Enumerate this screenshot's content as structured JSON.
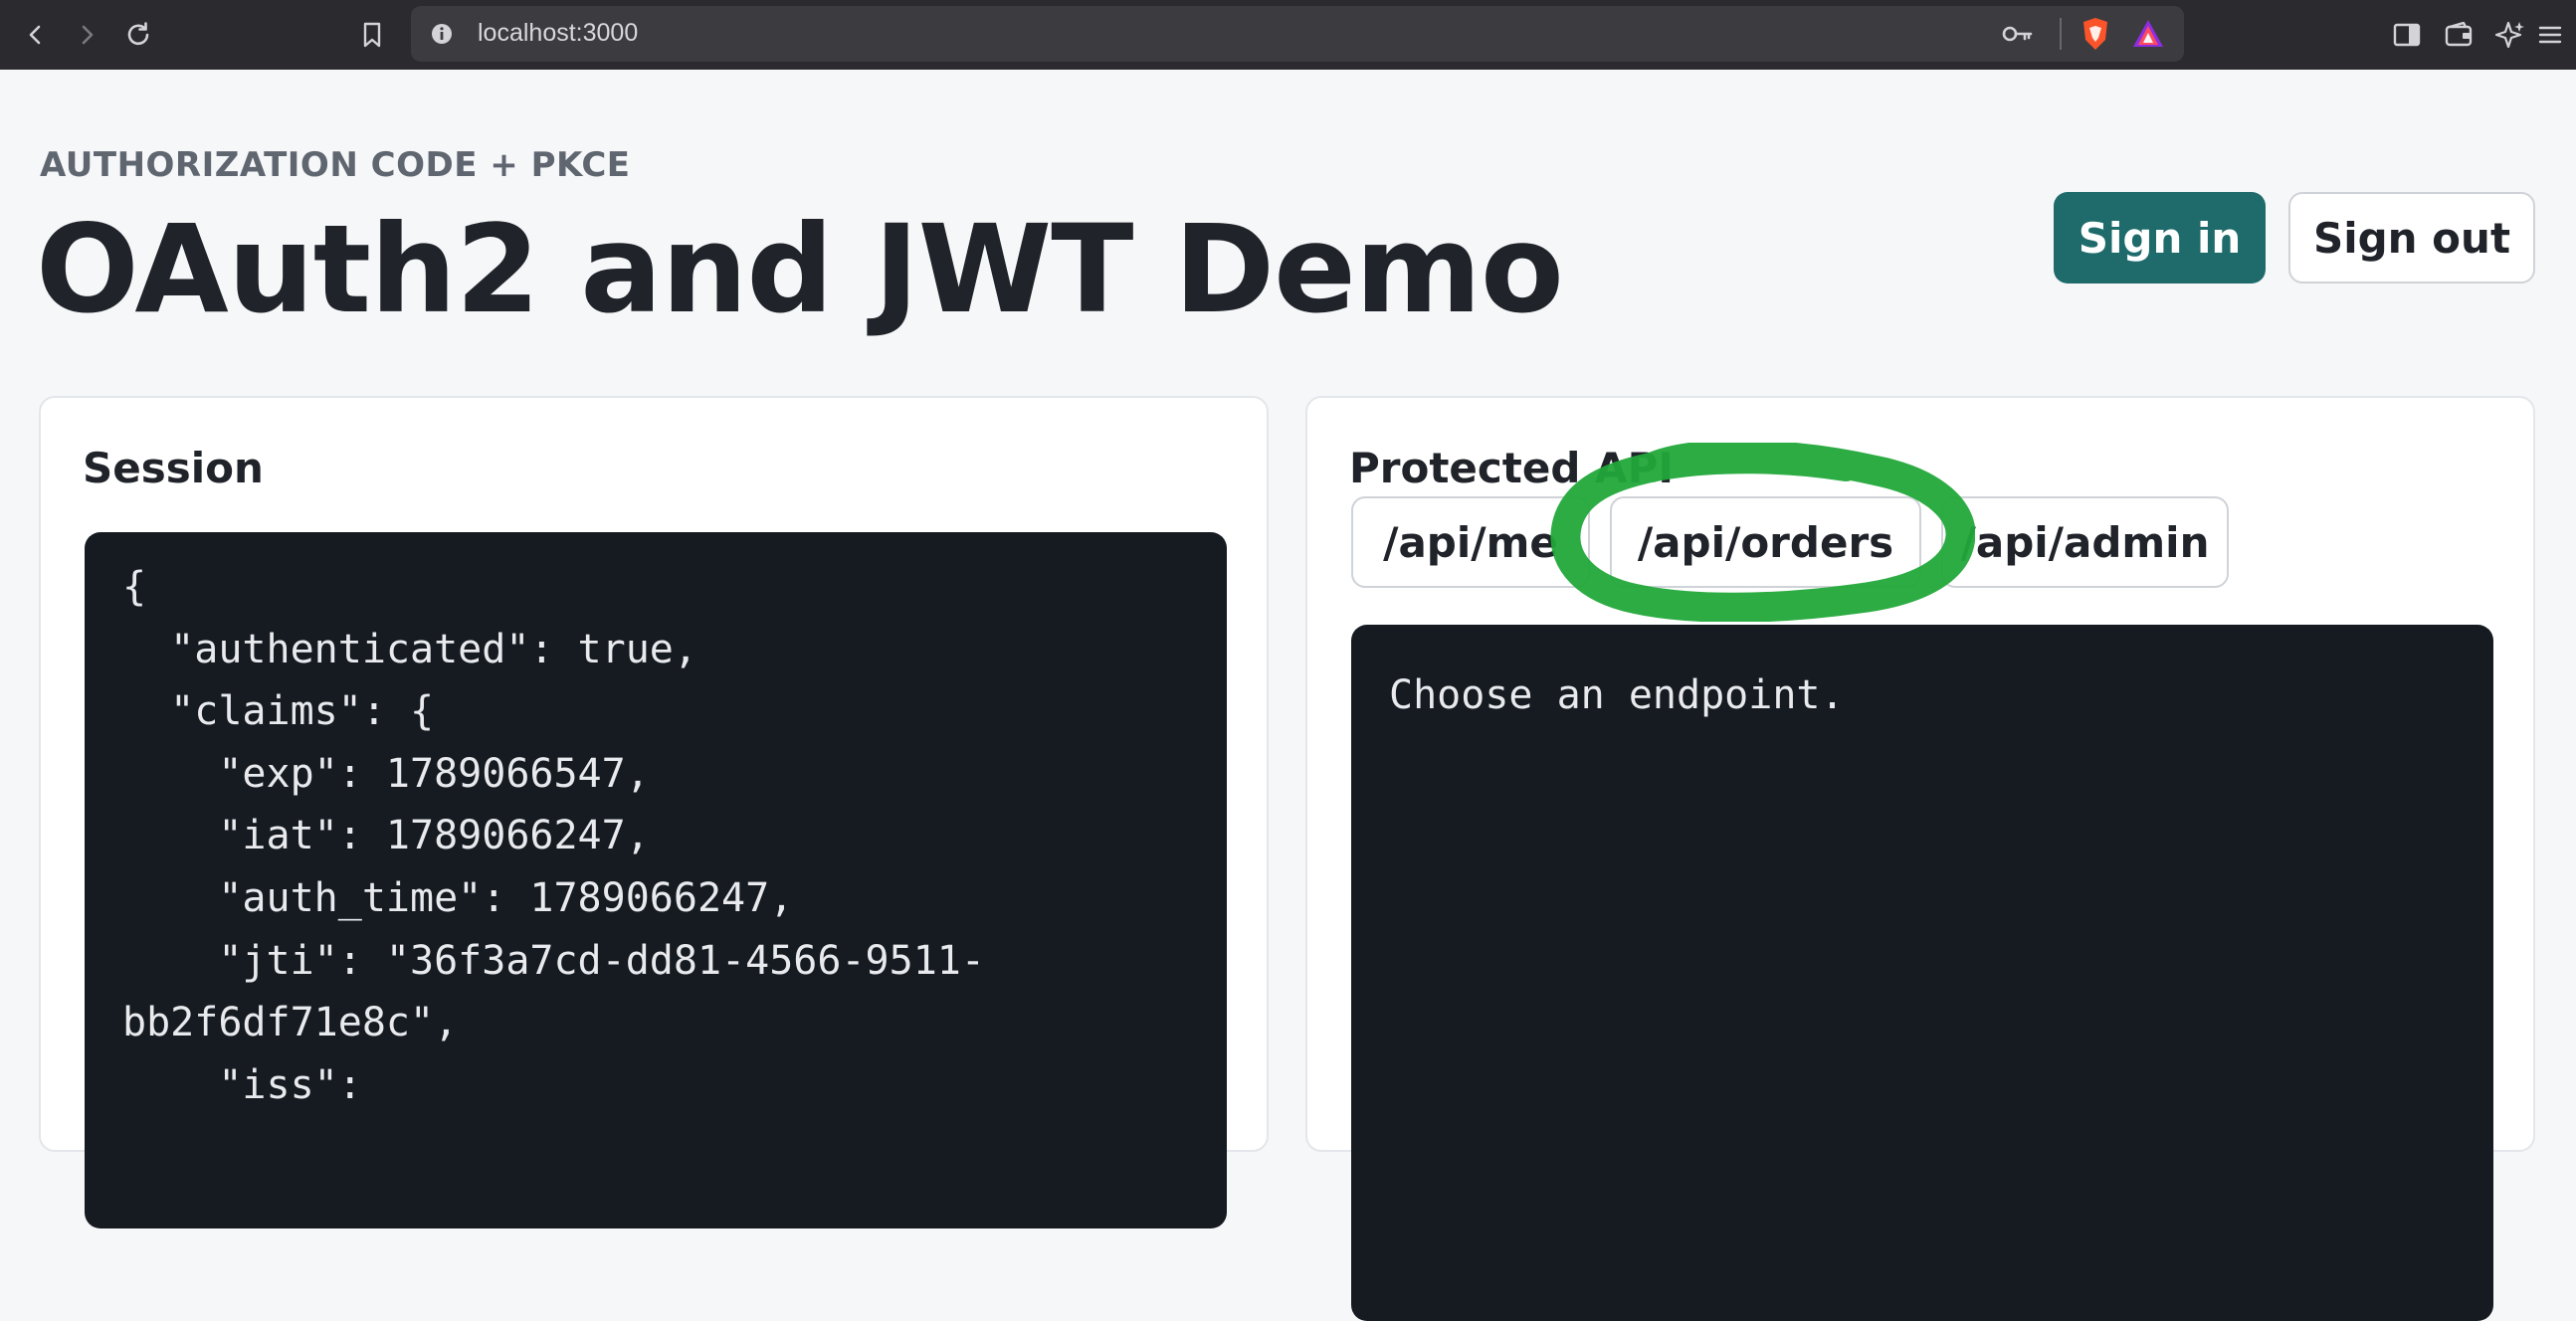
{
  "browser": {
    "url": "localhost:3000",
    "icons": [
      "back-arrow-icon",
      "forward-arrow-icon",
      "reload-icon",
      "bookmark-icon",
      "site-info-icon",
      "key-icon",
      "brave-shield-icon",
      "brave-rewards-icon",
      "sidebar-icon",
      "wallet-icon",
      "leo-ai-icon",
      "menu-icon"
    ],
    "colors": {
      "toolbar": "#2b2b2f",
      "urlbar": "#3c3c40"
    }
  },
  "header": {
    "eyebrow": "AUTHORIZATION CODE + PKCE",
    "title": "OAuth2 and JWT Demo",
    "sign_in_label": "Sign in",
    "sign_out_label": "Sign out"
  },
  "session": {
    "title": "Session",
    "json_text": "{\n  \"authenticated\": true,\n  \"claims\": {\n    \"exp\": 1789066547,\n    \"iat\": 1789066247,\n    \"auth_time\": 1789066247,\n    \"jti\": \"36f3a7cd-dd81-4566-9511-\nbb2f6df71e8c\",\n    \"iss\":"
  },
  "api": {
    "title": "Protected API",
    "endpoints": [
      {
        "label": "/api/me"
      },
      {
        "label": "/api/orders"
      },
      {
        "label": "/api/admin"
      }
    ],
    "output": "Choose an endpoint."
  },
  "theme": {
    "primary": "#1f6b6b",
    "code_bg": "#161b22",
    "highlight": "#22a83a"
  }
}
